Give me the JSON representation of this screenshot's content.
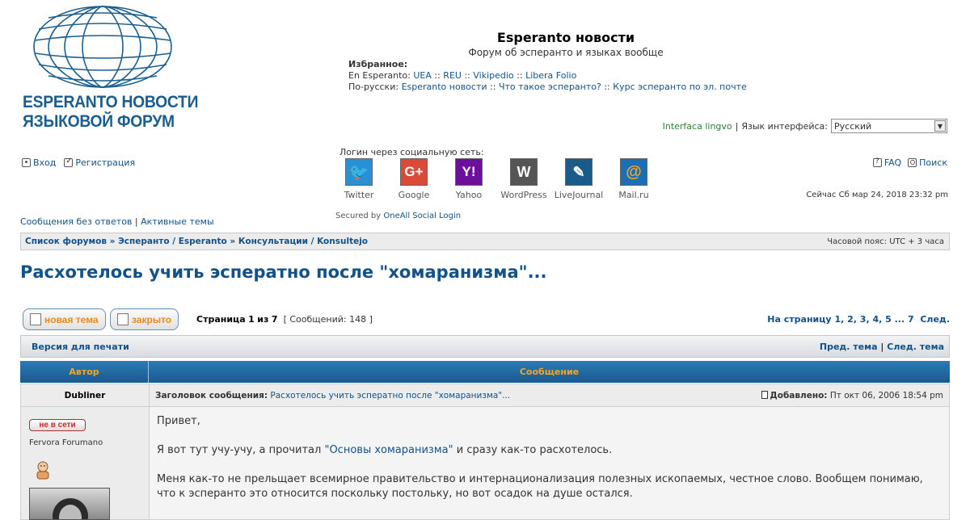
{
  "logo": {
    "line1": "ESPERANTO НОВОСТИ",
    "line2": "ЯЗЫКОВОЙ ФОРУМ",
    "color": "#1b5e8e",
    "icon": "globe-icon"
  },
  "header": {
    "title": "Esperanto новости",
    "description": "Форум об эсперанто и языках вообще",
    "favorites_label": "Избранное:",
    "eo_prefix": "En Esperanto:",
    "eo_links": [
      "UEA",
      "REU",
      "Vikipedio",
      "Libera Folio"
    ],
    "ru_prefix": "По-русски:",
    "ru_links": [
      "Esperanto новости",
      "Что такое эсперанто?",
      "Курс эсперанто по эл. почте"
    ],
    "separator": "::"
  },
  "language": {
    "interface_lingvo": "Interfaca lingvo",
    "divider": "|",
    "label": "Язык интерфейса:",
    "selected": "Русский"
  },
  "auth": {
    "login": "Вход",
    "register": "Регистрация"
  },
  "social": {
    "label": "Логин через социальную сеть:",
    "providers": [
      {
        "name": "Twitter",
        "glyph": "🐦",
        "color": "#2b8fd6"
      },
      {
        "name": "Google",
        "glyph": "G+",
        "color": "#d94a38"
      },
      {
        "name": "Yahoo",
        "glyph": "Y!",
        "color": "#6b0f9c"
      },
      {
        "name": "WordPress",
        "glyph": "W",
        "color": "#555555"
      },
      {
        "name": "LiveJournal",
        "glyph": "✎",
        "color": "#1b5b8a"
      },
      {
        "name": "Mail.ru",
        "glyph": "@",
        "color": "#1c6fb5"
      }
    ],
    "secured_prefix": "Secured by",
    "secured_link": "OneAll Social Login"
  },
  "tools": {
    "faq": "FAQ",
    "search": "Поиск",
    "now": "Сейчас Сб мар 24, 2018 23:32 pm"
  },
  "quicklinks": {
    "unanswered": "Сообщения без ответов",
    "divider": "|",
    "active": "Активные темы"
  },
  "breadcrumbs": {
    "items": [
      "Список форумов",
      "Эсперанто / Esperanto",
      "Консультации / Konsultejo"
    ],
    "sep": "»",
    "timezone": "Часовой пояс: UTC + 3 часа"
  },
  "topic": {
    "title": "Расхотелось учить эсператно после \"хомаранизма\"...",
    "new_topic_btn": "новая тема",
    "locked_btn": "закрыто",
    "page_prefix": "Страница",
    "page_current": "1",
    "page_of": "из",
    "page_total": "7",
    "posts_count": "[ Сообщений: 148 ]",
    "pagination_label": "На страницу",
    "pages": [
      "1",
      "2",
      "3",
      "4",
      "5",
      "...",
      "7"
    ],
    "next": "След."
  },
  "printbar": {
    "print": "Версия для печати",
    "prev_topic": "Пред. тема",
    "divider": "|",
    "next_topic": "След. тема"
  },
  "table": {
    "col_author": "Автор",
    "col_message": "Сообщение"
  },
  "post": {
    "author": "Dubliner",
    "subject_label": "Заголовок сообщения:",
    "subject": "Расхотелось учить эсператно после \"хомаранизма\"...",
    "added_label": "Добавлено:",
    "added_date": "Пт окт 06, 2006 18:54 pm",
    "status": "не в сети",
    "rank": "Fervora Forumano",
    "greeting": "Привет,",
    "p2_before": "Я вот тут учу-учу, а прочитал",
    "p2_link": "\"Основы хомаранизма\"",
    "p2_after": "и сразу как-то расхотелось.",
    "p3": "Меня как-то не прельщает всемирное правительство и интернационализация полезных ископаемых, честное слово. Вообщем понимаю, что к эсперанто это относится поскольку постольку, но вот осадок на душе остался."
  },
  "colors": {
    "link": "#105289",
    "accent_orange": "#f5a623",
    "header_blue": "#1a5a8f"
  }
}
